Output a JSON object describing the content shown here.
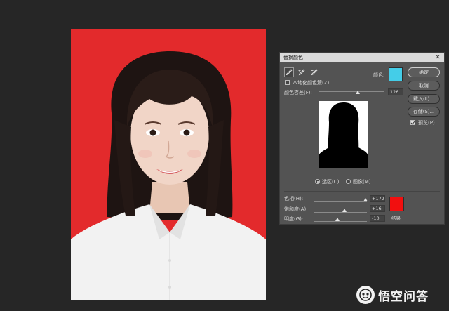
{
  "dialog": {
    "title": "替换颜色",
    "tools": [
      "eyedropper-icon",
      "eyedropper-plus-icon",
      "eyedropper-minus-icon"
    ],
    "localized_clusters_label": "本地化颜色簇(Z)",
    "localized_clusters_checked": false,
    "color_label": "颜色:",
    "selected_color": "#44cde8",
    "fuzziness_label": "颜色容差(F):",
    "fuzziness_value": "126",
    "fuzziness_fraction": 0.6,
    "view_options": {
      "selection_label": "选区(C)",
      "image_label": "图像(M)",
      "selected": "selection"
    },
    "hue_label": "色相(H):",
    "hue_value": "+172",
    "hue_fraction": 0.98,
    "saturation_label": "饱和度(A):",
    "saturation_value": "+16",
    "saturation_fraction": 0.58,
    "lightness_label": "明度(G):",
    "lightness_value": "-10",
    "lightness_fraction": 0.45,
    "result_label": "结果",
    "result_color": "#f20f0f",
    "buttons": {
      "ok": "确定",
      "cancel": "取消",
      "load": "载入(L)...",
      "save": "存储(S)..."
    },
    "preview_label": "预览(P)",
    "preview_checked": true
  },
  "photo": {
    "background_color": "#e32a2c"
  },
  "watermark": {
    "text": "悟空问答"
  }
}
